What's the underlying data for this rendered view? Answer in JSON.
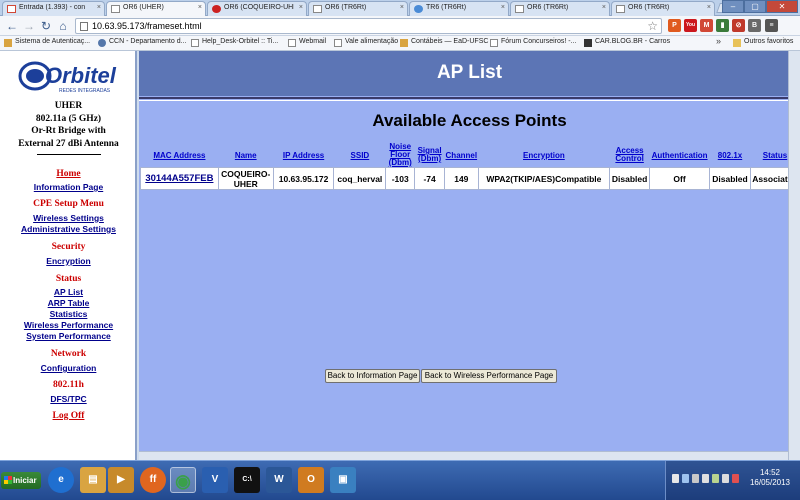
{
  "browser": {
    "tabs": [
      {
        "title": "Entrada (1.393) - con",
        "icon": "gmail-icon",
        "color": "#d14836"
      },
      {
        "title": "OR6 (UHER)",
        "icon": "page-icon",
        "color": "#888888",
        "active": true
      },
      {
        "title": "OR6 (COQUEIRO-UHE",
        "icon": "orbitel-icon",
        "color": "#cc2222"
      },
      {
        "title": "OR6 (TR6Rt)",
        "icon": "page-icon",
        "color": "#888888"
      },
      {
        "title": "TR6 (TR6Rt)",
        "icon": "chrome-icon",
        "color": "#4a8bd6"
      },
      {
        "title": "OR6 (TR6Rt)",
        "icon": "page-icon",
        "color": "#888888"
      },
      {
        "title": "OR6 (TR6Rt)",
        "icon": "page-icon",
        "color": "#888888"
      }
    ],
    "url": "10.63.95.173/frameset.html",
    "extensions": [
      {
        "name": "p-ext",
        "label": "P",
        "color": "#e05a1f"
      },
      {
        "name": "youtube-icon",
        "label": "You",
        "color": "#cc181e"
      },
      {
        "name": "gmail-ext",
        "label": "M",
        "color": "#d14836"
      },
      {
        "name": "chart-ext",
        "label": "▮",
        "color": "#3b7b3b"
      },
      {
        "name": "adblock-icon",
        "label": "⊘",
        "color": "#c0392b"
      },
      {
        "name": "bookmark-ext",
        "label": "B",
        "color": "#6a6a6a"
      },
      {
        "name": "wrench-icon",
        "label": "≡",
        "color": "#555555"
      }
    ],
    "bookmarks": [
      {
        "label": "Sistema de Autenticaç...",
        "color": "#d9a441"
      },
      {
        "label": "CCN - Departamento d...",
        "color": "#5577aa"
      },
      {
        "label": "Help_Desk-Orbitel :: Ti...",
        "color": "#888888"
      },
      {
        "label": "Webmail",
        "color": "#888888"
      },
      {
        "label": "Vale alimentação",
        "color": "#888888"
      },
      {
        "label": "Contábeis — EaD-UFSC",
        "color": "#d9a441"
      },
      {
        "label": "Fórum Concurseiros! -...",
        "color": "#888888"
      },
      {
        "label": "CAR.BLOG.BR - Carros",
        "color": "#333333"
      }
    ],
    "bookmarks_more": "»",
    "other_bookmarks": "Outros favoritos"
  },
  "sidebar": {
    "logo_text": "Orbitel",
    "logo_subtext": "REDES INTEGRADAS",
    "device_lines": [
      "UHER",
      "802.11a (5 GHz)",
      "Or-Rt Bridge with",
      "External 27 dBi Antenna"
    ],
    "home": "Home",
    "information_page": "Information Page",
    "cpe_setup_menu": "CPE Setup Menu",
    "wireless_settings": "Wireless Settings",
    "administrative_settings": "Administrative Settings",
    "security": "Security",
    "encryption": "Encryption",
    "status": "Status",
    "ap_list": "AP List",
    "arp_table": "ARP Table",
    "statistics": "Statistics",
    "wireless_performance": "Wireless Performance",
    "system_performance": "System Performance",
    "network": "Network",
    "configuration": "Configuration",
    "standard": "802.11h",
    "dfs_tpc": "DFS/TPC",
    "log_off": "Log Off"
  },
  "main": {
    "title": "AP List",
    "subtitle": "Available Access Points",
    "columns": [
      "MAC Address",
      "Name",
      "IP Address",
      "SSID",
      "Noise Floor (Dbm)",
      "Signal (Dbm)",
      "Channel",
      "Encryption",
      "Access Control",
      "Authentication",
      "802.1x",
      "Status"
    ],
    "rows": [
      [
        "30144A557FEB",
        "COQUEIRO-UHER",
        "10.63.95.172",
        "coq_herval",
        "-103",
        "-74",
        "149",
        "WPA2(TKIP/AES)Compatible",
        "Disabled",
        "Off",
        "Disabled",
        "Associated"
      ]
    ],
    "back_info_button": "Back to Information Page",
    "back_perf_button": "Back to Wireless Performance Page"
  },
  "taskbar": {
    "start_label": "Iniciar",
    "time": "14:52",
    "date": "16/05/2013",
    "apps": [
      {
        "name": "ie-icon",
        "label": "e",
        "color": "#1f6fd0"
      },
      {
        "name": "explorer-icon",
        "label": "▤",
        "color": "#d9a441"
      },
      {
        "name": "media-icon",
        "label": "▶",
        "color": "#c78a2b"
      },
      {
        "name": "firefox-icon",
        "label": "ff",
        "color": "#e0661f"
      },
      {
        "name": "chrome-icon",
        "label": "◉",
        "color": "#3aa04a",
        "active": true
      },
      {
        "name": "vnc-icon",
        "label": "V",
        "color": "#2a5fb0"
      },
      {
        "name": "cmd-icon",
        "label": "C:\\",
        "color": "#111111"
      },
      {
        "name": "word-icon",
        "label": "W",
        "color": "#2b5797"
      },
      {
        "name": "outlook-icon",
        "label": "O",
        "color": "#d07b20"
      },
      {
        "name": "paint-icon",
        "label": "▣",
        "color": "#3a80c0"
      }
    ]
  }
}
